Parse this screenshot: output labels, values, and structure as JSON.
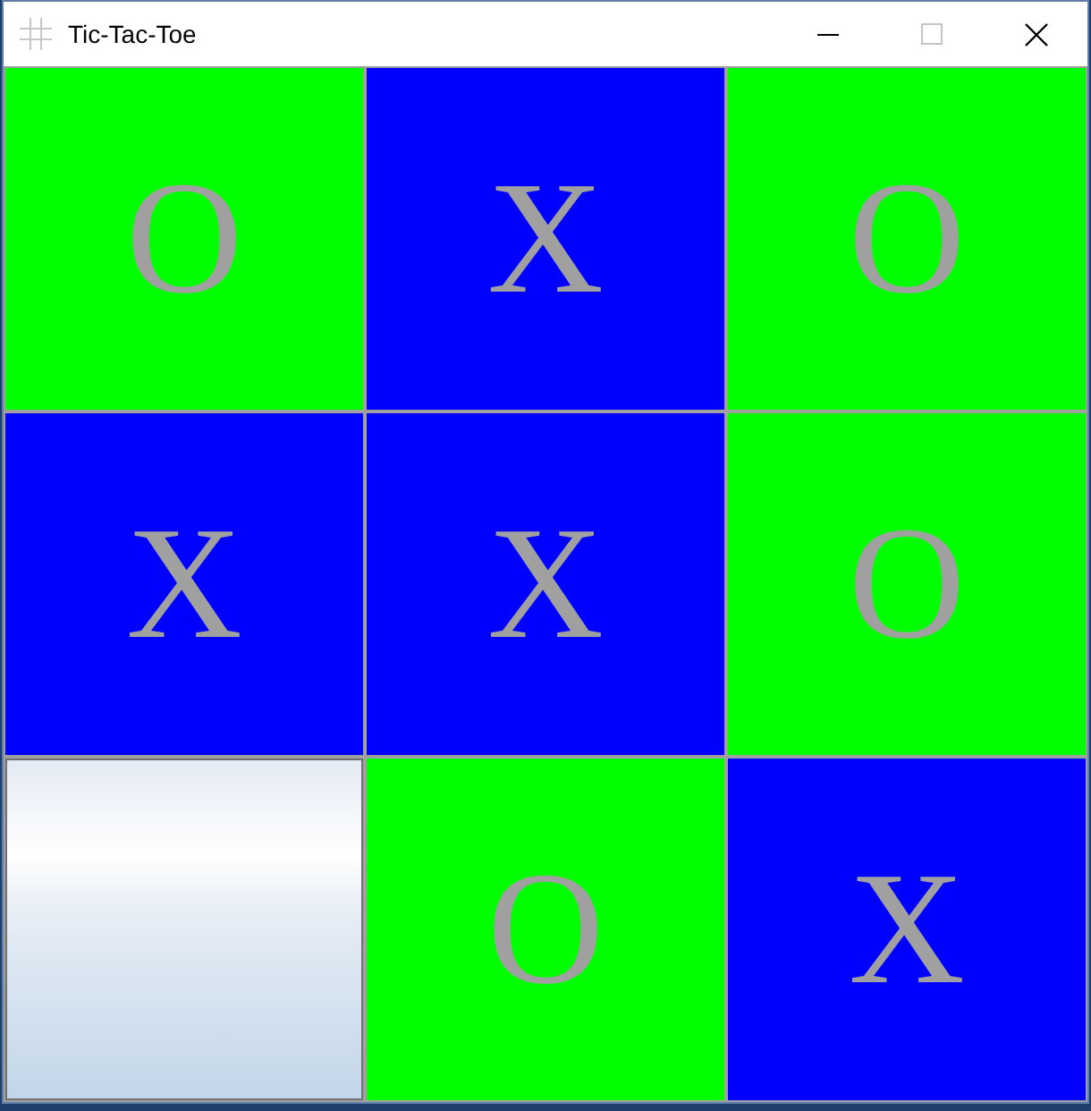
{
  "window": {
    "title": "Tic-Tac-Toe",
    "caption_buttons": [
      {
        "kind": "minimize",
        "disabled": false
      },
      {
        "kind": "maximize",
        "disabled": true
      },
      {
        "kind": "close",
        "disabled": false
      }
    ]
  },
  "board": {
    "rows": [
      {
        "cells": [
          {
            "kind": "taken",
            "text": "O",
            "color": "#00ff00"
          },
          {
            "kind": "taken",
            "text": "X",
            "color": "#0000ff"
          },
          {
            "kind": "taken",
            "text": "O",
            "color": "#00ff00"
          }
        ]
      },
      {
        "cells": [
          {
            "kind": "taken",
            "text": "X",
            "color": "#0000ff"
          },
          {
            "kind": "taken",
            "text": "X",
            "color": "#0000ff"
          },
          {
            "kind": "taken",
            "text": "O",
            "color": "#00ff00"
          }
        ]
      },
      {
        "cells": [
          {
            "kind": "empty"
          },
          {
            "kind": "taken",
            "text": "O",
            "color": "#00ff00"
          },
          {
            "kind": "taken",
            "text": "X",
            "color": "#0000ff"
          }
        ]
      }
    ]
  }
}
